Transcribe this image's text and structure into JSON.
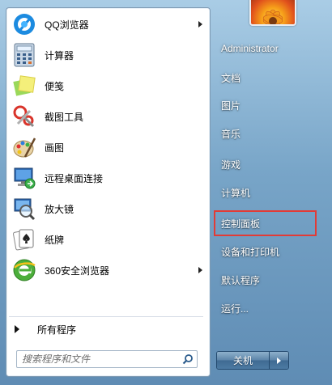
{
  "programs": [
    {
      "label": "QQ浏览器",
      "icon": "qq-browser-icon",
      "has_submenu": true
    },
    {
      "label": "计算器",
      "icon": "calculator-icon",
      "has_submenu": false
    },
    {
      "label": "便笺",
      "icon": "sticky-notes-icon",
      "has_submenu": false
    },
    {
      "label": "截图工具",
      "icon": "snipping-tool-icon",
      "has_submenu": false
    },
    {
      "label": "画图",
      "icon": "paint-icon",
      "has_submenu": false
    },
    {
      "label": "远程桌面连接",
      "icon": "remote-desktop-icon",
      "has_submenu": false
    },
    {
      "label": "放大镜",
      "icon": "magnifier-icon",
      "has_submenu": false
    },
    {
      "label": "纸牌",
      "icon": "solitaire-icon",
      "has_submenu": false
    },
    {
      "label": "360安全浏览器",
      "icon": "360-browser-icon",
      "has_submenu": true
    }
  ],
  "all_programs_label": "所有程序",
  "search": {
    "placeholder": "搜索程序和文件"
  },
  "right_menu": [
    {
      "label": "Administrator"
    },
    {
      "label": "文档"
    },
    {
      "label": "图片"
    },
    {
      "label": "音乐"
    },
    {
      "label": "游戏"
    },
    {
      "label": "计算机"
    },
    {
      "label": "控制面板",
      "highlighted": true
    },
    {
      "label": "设备和打印机"
    },
    {
      "label": "默认程序"
    },
    {
      "label": "运行..."
    }
  ],
  "shutdown_label": "关机",
  "colors": {
    "highlight_border": "#e23b36",
    "accent": "#1e63b0"
  }
}
